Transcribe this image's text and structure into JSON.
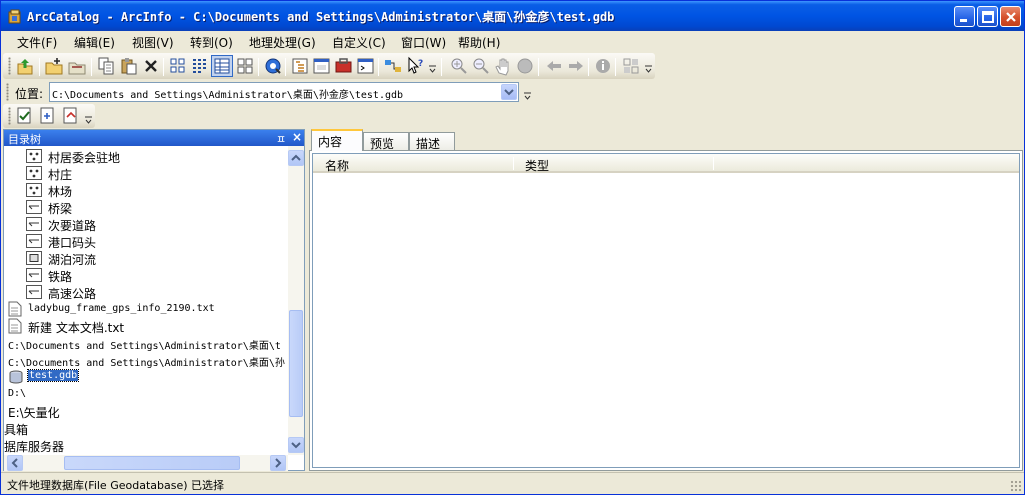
{
  "window": {
    "title": "ArcCatalog - ArcInfo - C:\\Documents and Settings\\Administrator\\桌面\\孙金彦\\test.gdb"
  },
  "menu": [
    "文件(F)",
    "编辑(E)",
    "视图(V)",
    "转到(O)",
    "地理处理(G)",
    "自定义(C)",
    "窗口(W)",
    "帮助(H)"
  ],
  "location": {
    "label": "位置:",
    "value": "C:\\Documents and Settings\\Administrator\\桌面\\孙金彦\\test.gdb"
  },
  "tree": {
    "title": "目录树",
    "items": [
      {
        "label": "村居委会驻地",
        "icon": "point-feature-icon"
      },
      {
        "label": "村庄",
        "icon": "point-feature-icon"
      },
      {
        "label": "林场",
        "icon": "point-feature-icon"
      },
      {
        "label": "桥梁",
        "icon": "line-feature-icon"
      },
      {
        "label": "次要道路",
        "icon": "line-feature-icon"
      },
      {
        "label": "港口码头",
        "icon": "line-feature-icon"
      },
      {
        "label": "湖泊河流",
        "icon": "polygon-feature-icon"
      },
      {
        "label": "铁路",
        "icon": "line-feature-icon"
      },
      {
        "label": "高速公路",
        "icon": "line-feature-icon"
      },
      {
        "label": "ladybug_frame_gps_info_2190.txt",
        "icon": "text-file-icon"
      },
      {
        "label": "新建 文本文档.txt",
        "icon": "text-file-icon"
      },
      {
        "label": "C:\\Documents and Settings\\Administrator\\桌面\\t",
        "icon": ""
      },
      {
        "label": "C:\\Documents and Settings\\Administrator\\桌面\\孙",
        "icon": ""
      },
      {
        "label": "test.gdb",
        "icon": "geodatabase-icon"
      },
      {
        "label": "D:\\",
        "icon": ""
      },
      {
        "label": "E:\\矢量化",
        "icon": ""
      },
      {
        "label": "具箱",
        "icon": ""
      },
      {
        "label": "据库服务器",
        "icon": ""
      }
    ]
  },
  "tabs": [
    "内容",
    "预览",
    "描述"
  ],
  "columns": [
    "名称",
    "类型"
  ],
  "status": "文件地理数据库(File Geodatabase) 已选择",
  "colors": {
    "title_blue": "#0054e3",
    "selection": "#316ac5",
    "panel_header": "#2157c9"
  },
  "toolbar_icons": [
    "up-one-level-icon",
    "connect-folder-icon",
    "disconnect-folder-icon",
    "copy-icon",
    "paste-icon",
    "delete-icon",
    "large-icons-view-icon",
    "list-view-icon",
    "details-view-icon",
    "thumbnails-view-icon",
    "launch-arcmap-icon",
    "catalog-tree-icon",
    "search-window-icon",
    "arctoolbox-icon",
    "python-window-icon",
    "model-builder-icon",
    "whats-this-icon",
    "zoom-in-icon",
    "zoom-out-icon",
    "pan-icon",
    "full-extent-icon",
    "back-icon",
    "forward-icon",
    "identify-icon",
    "create-thumbnail-icon"
  ]
}
